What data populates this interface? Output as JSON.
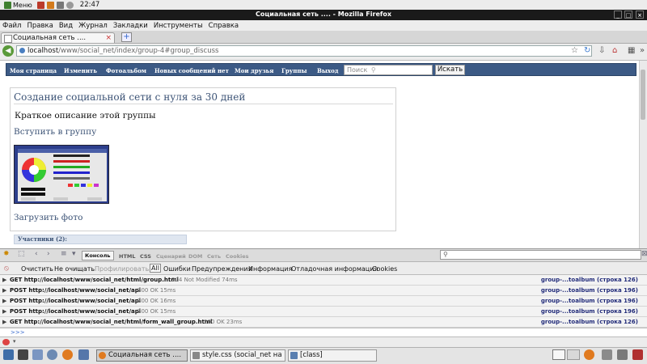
{
  "top_panel": {
    "menu_label": "Меню",
    "clock": "22:47"
  },
  "window": {
    "title": "Социальная сеть .... - Mozilla Firefox"
  },
  "menubar": {
    "items": [
      "Файл",
      "Правка",
      "Вид",
      "Журнал",
      "Закладки",
      "Инструменты",
      "Справка"
    ]
  },
  "tab": {
    "label": "Социальная сеть ....",
    "close": "×",
    "new_tab": "+"
  },
  "address": {
    "host": "localhost",
    "path": "/www/social_net/index/group-4#group_discuss"
  },
  "site": {
    "nav": [
      "Моя страница",
      "Изменить",
      "Фотоальбом",
      "Новых сообщений нет",
      "Мои друзья",
      "Группы",
      "Выход"
    ],
    "search_placeholder": "Поиск",
    "search_button": "Искать",
    "group_title": "Создание социальной сети с нуля за 30 дней",
    "group_description": "Краткое описание этой группы",
    "join_link": "Вступить в группу",
    "upload_link": "Загрузить фото",
    "members_label": "Участники (2):"
  },
  "firebug": {
    "console_tab": "Консоль ▾",
    "tabs": [
      "HTML",
      "CSS",
      "Сценарий",
      "DOM",
      "Сеть",
      "Cookies"
    ],
    "tools": {
      "clear": "Очистить",
      "persist": "Не очищать",
      "profile": "Профилировать",
      "filters": [
        "All",
        "Ошибки",
        "Предупреждения",
        "Информация",
        "Отладочная информация",
        "Cookies"
      ]
    },
    "log": [
      {
        "request": "GET http://localhost/www/social_net/html/group.html",
        "status": "304 Not Modified 74ms",
        "source": "group-...toalbum (строка 126)"
      },
      {
        "request": "POST http://localhost/www/social_net/api",
        "status": "200 OK 15ms",
        "source": "group-...toalbum (строка 196)"
      },
      {
        "request": "POST http://localhost/www/social_net/api",
        "status": "200 OK 16ms",
        "source": "group-...toalbum (строка 196)"
      },
      {
        "request": "POST http://localhost/www/social_net/api",
        "status": "200 OK 15ms",
        "source": "group-...toalbum (строка 196)"
      },
      {
        "request": "GET http://localhost/www/social_net/html/form_wall_group.html",
        "status": "200 OK 23ms",
        "source": "group-...toalbum (строка 126)"
      }
    ],
    "command_prompt": ">>>"
  },
  "taskbar": {
    "windows": [
      "Социальная сеть ....",
      "style.css (social_net на ...",
      "[class]"
    ]
  },
  "colors": {
    "site_nav_bg": "#3c5a85",
    "link_color": "#3b5275",
    "log_source": "#222c7a"
  }
}
